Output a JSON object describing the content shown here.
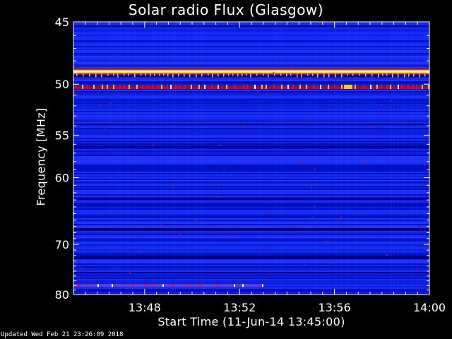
{
  "chart_data": {
    "type": "heatmap",
    "title": "Solar radio Flux (Glasgow)",
    "xlabel": "Start Time (11-Jun-14 13:45:00)",
    "ylabel": "Frequency [MHz]",
    "x_ticks": [
      "13:48",
      "13:52",
      "13:56",
      "14:00"
    ],
    "x_tick_minutes": [
      3,
      7,
      11,
      15
    ],
    "xlim_minutes": [
      0,
      15
    ],
    "y_ticks": [
      45,
      50,
      55,
      60,
      70,
      80
    ],
    "ylim": [
      45,
      80
    ],
    "y_scale": "reciprocal",
    "colormap": [
      "#000060",
      "#0010c0",
      "#1a2fff",
      "#ff0000",
      "#ffcc00",
      "#ffffff"
    ],
    "bright_bands_mhz": [
      {
        "freq": 48.9,
        "level": "max",
        "span_minutes": [
          0,
          15
        ]
      },
      {
        "freq": 50.3,
        "level": "high",
        "span_minutes": [
          0,
          15
        ]
      },
      {
        "freq": 78.0,
        "level": "medium",
        "span_minutes": [
          0,
          8
        ]
      }
    ]
  },
  "footer": "Updated Wed Feb 21 23:26:09 2018"
}
